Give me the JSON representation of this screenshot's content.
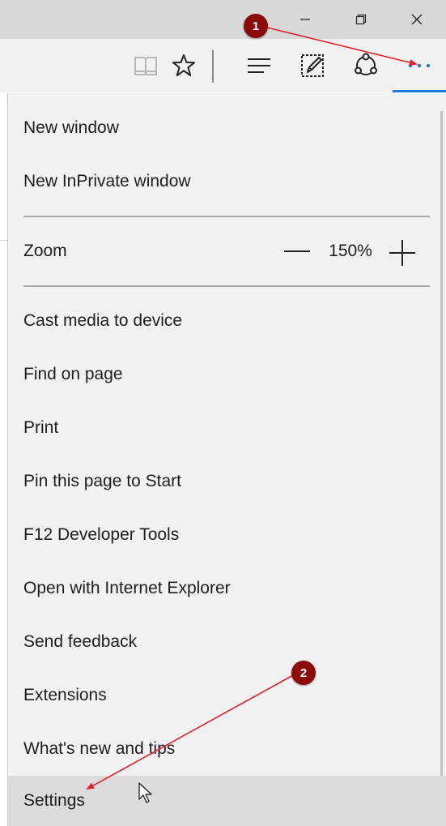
{
  "window_controls": {
    "minimize_icon": "minimize-icon",
    "restore_icon": "restore-icon",
    "close_icon": "close-icon"
  },
  "toolbar": {
    "icons": [
      "reading-view-icon",
      "favorite-star-icon",
      "hub-icon",
      "web-note-icon",
      "share-icon",
      "more-icon"
    ],
    "accent_color": "#1e7ad6"
  },
  "menu": {
    "items_top": [
      {
        "label": "New window"
      },
      {
        "label": "New InPrivate window"
      }
    ],
    "zoom": {
      "label": "Zoom",
      "value": "150%"
    },
    "items_bottom": [
      {
        "label": "Cast media to device"
      },
      {
        "label": "Find on page"
      },
      {
        "label": "Print"
      },
      {
        "label": "Pin this page to Start"
      },
      {
        "label": "F12 Developer Tools"
      },
      {
        "label": "Open with Internet Explorer"
      },
      {
        "label": "Send feedback"
      },
      {
        "label": "Extensions"
      },
      {
        "label": "What's new and tips"
      },
      {
        "label": "Settings",
        "active": true
      }
    ]
  },
  "annotations": [
    {
      "number": "1",
      "color": "#8b0a0a",
      "arrow_color": "#e8202a"
    },
    {
      "number": "2",
      "color": "#8b0a0a",
      "arrow_color": "#e8202a"
    }
  ]
}
